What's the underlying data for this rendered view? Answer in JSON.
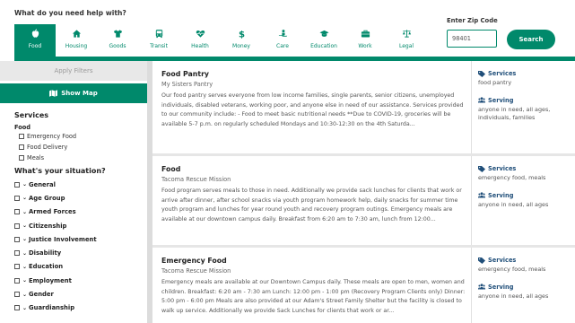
{
  "header": {
    "question": "What do you need help with?",
    "categories": [
      {
        "label": "Food",
        "icon": "apple-icon",
        "active": true
      },
      {
        "label": "Housing",
        "icon": "home-icon",
        "active": false
      },
      {
        "label": "Goods",
        "icon": "shirt-icon",
        "active": false
      },
      {
        "label": "Transit",
        "icon": "bus-icon",
        "active": false
      },
      {
        "label": "Health",
        "icon": "heartbeat-icon",
        "active": false
      },
      {
        "label": "Money",
        "icon": "dollar-icon",
        "active": false
      },
      {
        "label": "Care",
        "icon": "care-hand-icon",
        "active": false
      },
      {
        "label": "Education",
        "icon": "graduation-cap-icon",
        "active": false
      },
      {
        "label": "Work",
        "icon": "briefcase-icon",
        "active": false
      },
      {
        "label": "Legal",
        "icon": "balance-scale-icon",
        "active": false
      }
    ],
    "zip_label": "Enter Zip Code",
    "zip_value": "98401",
    "search_label": "Search"
  },
  "sidebar": {
    "apply_filters_label": "Apply Filters",
    "show_map_label": "Show Map",
    "services_heading": "Services",
    "food_heading": "Food",
    "food_options": [
      "Emergency Food",
      "Food Delivery",
      "Meals"
    ],
    "situation_heading": "What's your situation?",
    "situations": [
      "General",
      "Age Group",
      "Armed Forces",
      "Citizenship",
      "Justice Involvement",
      "Disability",
      "Education",
      "Employment",
      "Gender",
      "Guardianship"
    ]
  },
  "results": [
    {
      "title": "Food Pantry",
      "org": "My Sisters Pantry",
      "description": "Our food pantry serves everyone from low income families, single parents, senior citizens, unemployed individuals, disabled veterans, working poor, and anyone else in need of our assistance. Services provided to our community include: - Food to meet basic nutritional needs **Due to COVID-19, groceries will be available 5-7 p.m. on regularly scheduled Mondays and 10:30-12:30 on the 4th Saturda...",
      "services_label": "Services",
      "services": "food pantry",
      "serving_label": "Serving",
      "serving": "anyone in need, all ages, individuals, families"
    },
    {
      "title": "Food",
      "org": "Tacoma Rescue Mission",
      "description": "Food program serves meals to those in need. Additionally we provide sack lunches for clients that work or arrive after dinner, after school snacks via youth program homework help, daily snacks for summer time youth program and lunches for year round youth and recovery program outings. Emergency meals are available at our downtown campus daily. Breakfast from 6:20 am to 7:30 am, lunch from 12:00...",
      "services_label": "Services",
      "services": "emergency food, meals",
      "serving_label": "Serving",
      "serving": "anyone in need, all ages"
    },
    {
      "title": "Emergency Food",
      "org": "Tacoma Rescue Mission",
      "description": "Emergency meals are available at our Downtown Campus daily. These meals are open to men, women and children. Breakfast: 6:20 am - 7:30 am Lunch: 12:00 pm - 1:00 pm (Recovery Program Clients only) Dinner: 5:00 pm - 6:00 pm Meals are also provided at our Adam's Street Family Shelter but the facility is closed to walk up service. Additionally we provide Sack Lunches for clients that work or ar...",
      "services_label": "Services",
      "services": "emergency food, meals",
      "serving_label": "Serving",
      "serving": "anyone in need, all ages"
    }
  ],
  "colors": {
    "accent": "#00896b",
    "label_blue": "#1f4e79"
  }
}
